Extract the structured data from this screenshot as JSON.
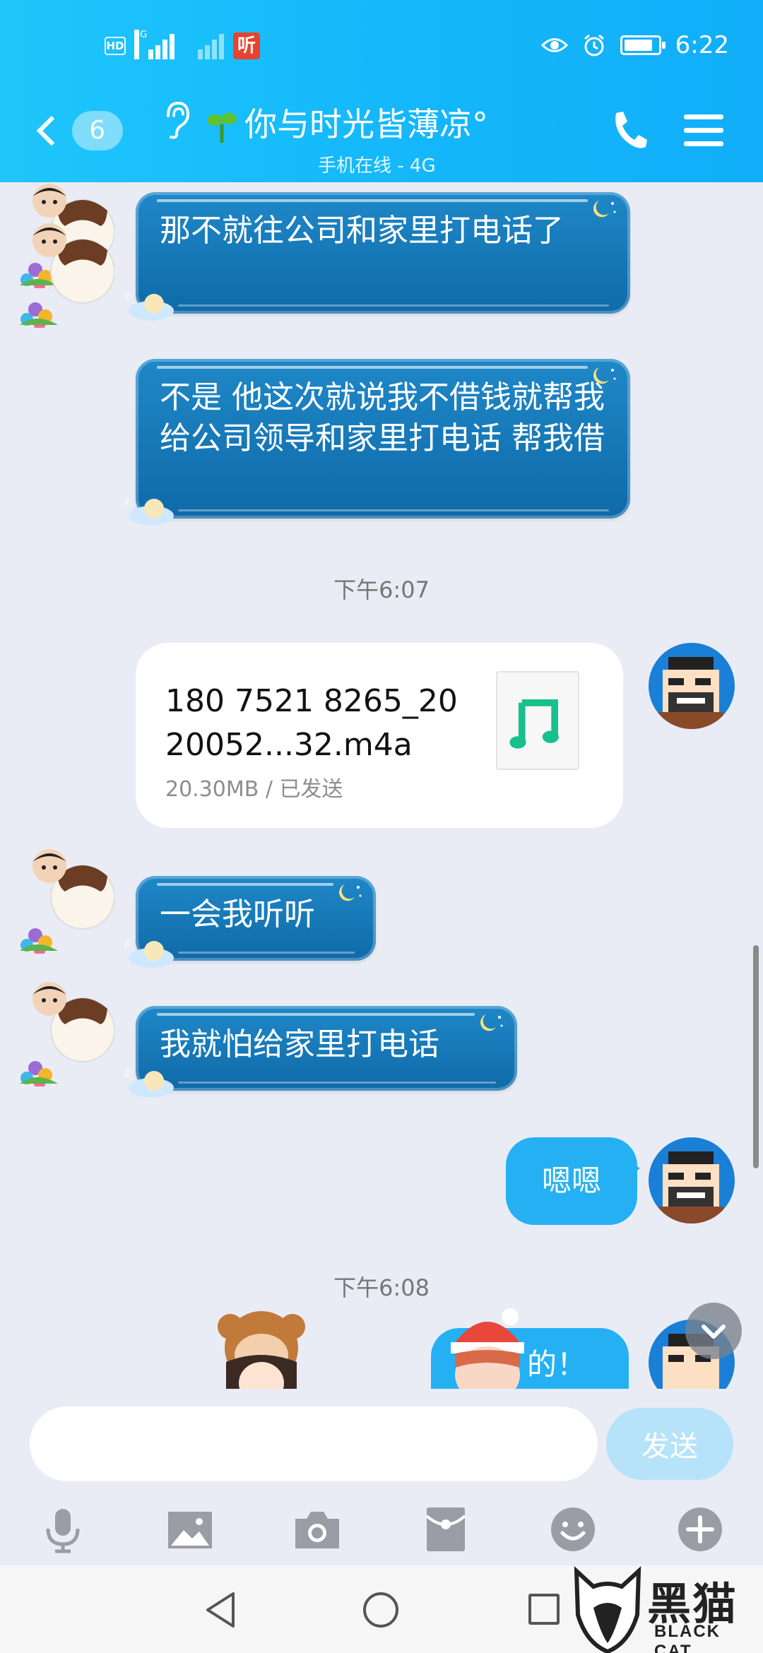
{
  "status_bar": {
    "time": "6:22",
    "network_hd": "HD",
    "network_4g": "4G",
    "app_badge": "听",
    "battery_level": 0.85
  },
  "header": {
    "back_count": "6",
    "title": "你与时光皆薄凉°",
    "subtitle": "手机在线 - 4G"
  },
  "messages": [
    {
      "side": "left",
      "text": "那不就往公司和家里打电话了"
    },
    {
      "side": "left",
      "text": "不是  他这次就说我不借钱就帮我给公司领导和家里打电话  帮我借"
    },
    {
      "type": "time",
      "text": "下午6:07"
    },
    {
      "side": "right",
      "type": "file",
      "name": "180 7521 8265_2020052...32.m4a",
      "meta": "20.30MB / 已发送"
    },
    {
      "side": "left",
      "text": "一会我听听"
    },
    {
      "side": "left",
      "text": "我就怕给家里打电话"
    },
    {
      "side": "right",
      "text": "嗯嗯"
    },
    {
      "type": "time",
      "text": "下午6:08"
    },
    {
      "side": "right",
      "type": "sticker",
      "text": "的！"
    }
  ],
  "input": {
    "value": "",
    "send_label": "发送"
  },
  "toolbar": [
    "mic-icon",
    "image-icon",
    "camera-icon",
    "red-packet-icon",
    "emoji-icon",
    "plus-icon"
  ],
  "watermark": {
    "cn": "黑猫",
    "en": "BLACK CAT"
  },
  "colors": {
    "header": "#14b7fb",
    "bubble_blue": "#1479b8",
    "bubble_light": "#25b0f4",
    "background": "#e9ecf5"
  }
}
